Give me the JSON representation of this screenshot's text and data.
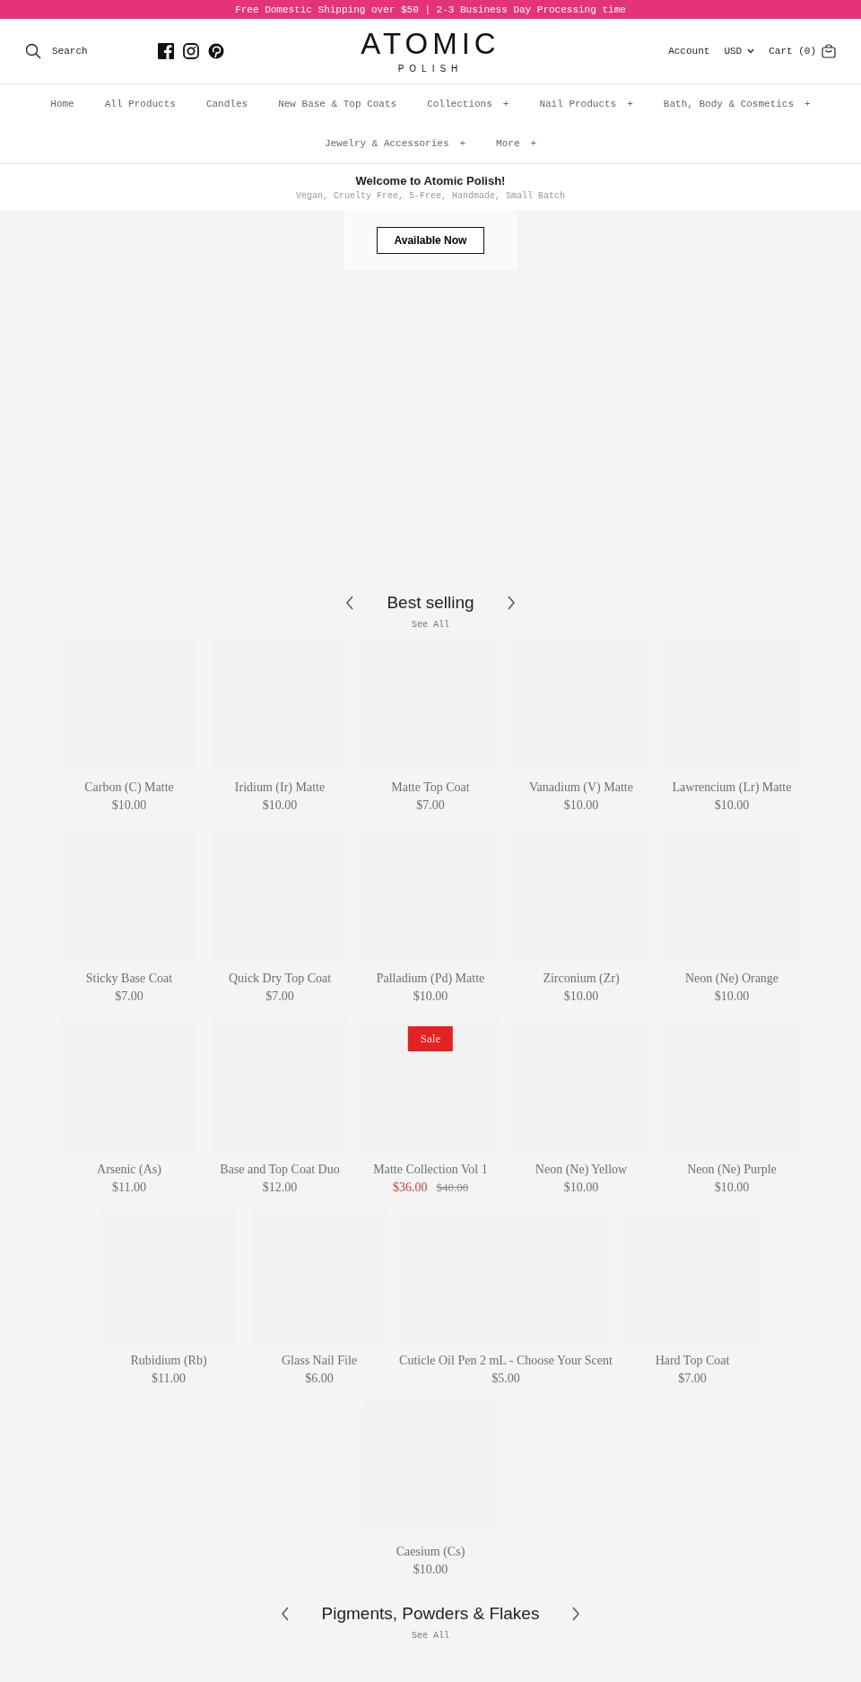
{
  "announcement": "Free Domestic Shipping over $50 | 2-3 Business Day Processing time",
  "header": {
    "search": "Search",
    "logo": {
      "title": "ATOMIC",
      "subtitle": "POLISH"
    },
    "account": "Account",
    "currency": "USD",
    "cart": "Cart (0)"
  },
  "nav": [
    {
      "label": "Home",
      "expandable": false
    },
    {
      "label": "All Products",
      "expandable": false
    },
    {
      "label": "Candles",
      "expandable": false
    },
    {
      "label": "New Base & Top Coats",
      "expandable": false
    },
    {
      "label": "Collections",
      "expandable": true,
      "marker": "+"
    },
    {
      "label": "Nail Products",
      "expandable": true,
      "marker": "+"
    },
    {
      "label": "Bath, Body & Cosmetics",
      "expandable": true,
      "marker": "+"
    },
    {
      "label": "Jewelry & Accessories",
      "expandable": true,
      "marker": "+"
    },
    {
      "label": "More",
      "expandable": true,
      "marker": "+"
    }
  ],
  "welcome": {
    "title": "Welcome to Atomic Polish!",
    "subtitle": "Vegan, Cruelty Free, 5-Free, Handmade, Small Batch"
  },
  "hero": {
    "button": "Available Now"
  },
  "best_selling": {
    "title": "Best selling",
    "see_all": "See All",
    "products": [
      {
        "name": "Carbon (C) Matte",
        "price": "$10.00"
      },
      {
        "name": "Iridium (Ir) Matte",
        "price": "$10.00"
      },
      {
        "name": "Matte Top Coat",
        "price": "$7.00"
      },
      {
        "name": "Vanadium (V) Matte",
        "price": "$10.00"
      },
      {
        "name": "Lawrencium (Lr) Matte",
        "price": "$10.00"
      },
      {
        "name": "Sticky Base Coat",
        "price": "$7.00"
      },
      {
        "name": "Quick Dry Top Coat",
        "price": "$7.00"
      },
      {
        "name": "Palladium (Pd) Matte",
        "price": "$10.00"
      },
      {
        "name": "Zirconium (Zr)",
        "price": "$10.00"
      },
      {
        "name": "Neon (Ne) Orange",
        "price": "$10.00"
      },
      {
        "name": "Arsenic (As)",
        "price": "$11.00"
      },
      {
        "name": "Base and Top Coat Duo",
        "price": "$12.00"
      },
      {
        "name": "Matte Collection Vol 1",
        "price": "$36.00",
        "compare_price": "$40.00",
        "badge": "Sale"
      },
      {
        "name": "Neon (Ne) Yellow",
        "price": "$10.00"
      },
      {
        "name": "Neon (Ne) Purple",
        "price": "$10.00"
      },
      {
        "name": "Rubidium (Rb)",
        "price": "$11.00"
      },
      {
        "name": "Glass Nail File",
        "price": "$6.00"
      },
      {
        "name": "Cuticle Oil Pen 2 mL - Choose Your Scent",
        "price": "$5.00"
      },
      {
        "name": "Hard Top Coat",
        "price": "$7.00"
      },
      {
        "name": "Caesium (Cs)",
        "price": "$10.00"
      }
    ]
  },
  "pigments": {
    "title": "Pigments, Powders & Flakes",
    "see_all": "See All"
  }
}
